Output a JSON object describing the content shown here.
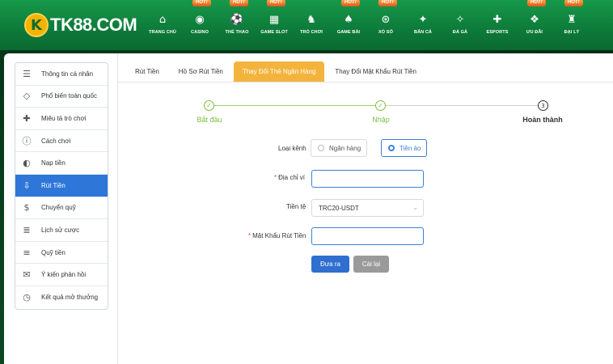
{
  "brand": {
    "logo_mark": "K",
    "logo_text": "TK88.COM",
    "accent": "#0d7a39",
    "gold": "#f5b301"
  },
  "nav": [
    {
      "label": "TRANG CHỦ",
      "icon": "home-icon",
      "glyph": "⌂",
      "hot": false
    },
    {
      "label": "CASINO",
      "icon": "casino-chip-icon",
      "glyph": "◉",
      "hot": true
    },
    {
      "label": "THỂ THAO",
      "icon": "soccer-ball-icon",
      "glyph": "⚽",
      "hot": true
    },
    {
      "label": "GAME SLOT",
      "icon": "slot-machine-icon",
      "glyph": "▦",
      "hot": true
    },
    {
      "label": "TRÒ CHƠI",
      "icon": "chess-knight-icon",
      "glyph": "♞",
      "hot": false
    },
    {
      "label": "GAME BÀI",
      "icon": "cards-icon",
      "glyph": "♠",
      "hot": true
    },
    {
      "label": "XỔ SỐ",
      "icon": "lottery-ball-icon",
      "glyph": "⊛",
      "hot": true
    },
    {
      "label": "BẮN CÁ",
      "icon": "fish-icon",
      "glyph": "✦",
      "hot": false
    },
    {
      "label": "ĐÁ GÀ",
      "icon": "rooster-icon",
      "glyph": "✧",
      "hot": false
    },
    {
      "label": "ESPORTS",
      "icon": "gamepad-icon",
      "glyph": "✚",
      "hot": false
    },
    {
      "label": "ƯU ĐÃI",
      "icon": "gift-icon",
      "glyph": "❖",
      "hot": true
    },
    {
      "label": "ĐẠI LÝ",
      "icon": "agent-icon",
      "glyph": "♜",
      "hot": true
    }
  ],
  "hot_label": "HOT!",
  "sidebar": {
    "items": [
      {
        "label": "Thông tin cá nhân",
        "icon": "profile-card-icon",
        "glyph": "☰",
        "active": false
      },
      {
        "label": "Phổ biến toàn quốc",
        "icon": "diamond-icon",
        "glyph": "◇",
        "active": false
      },
      {
        "label": "Miêu tả trò chơi",
        "icon": "gamepad-icon",
        "glyph": "✚",
        "active": false
      },
      {
        "label": "Cách chơi",
        "icon": "info-icon",
        "glyph": "ⓘ",
        "active": false
      },
      {
        "label": "Nạp tiền",
        "icon": "piggy-bank-icon",
        "glyph": "◐",
        "active": false
      },
      {
        "label": "Rút Tiền",
        "icon": "withdraw-icon",
        "glyph": "⇩",
        "active": true
      },
      {
        "label": "Chuyển quỹ",
        "icon": "transfer-coin-icon",
        "glyph": "$",
        "active": false
      },
      {
        "label": "Lịch sử cược",
        "icon": "history-list-icon",
        "glyph": "≣",
        "active": false
      },
      {
        "label": "Quỹ tiền",
        "icon": "funds-icon",
        "glyph": "≡",
        "active": false
      },
      {
        "label": "Ý kiến phản hồi",
        "icon": "chat-bubble-icon",
        "glyph": "✉",
        "active": false
      },
      {
        "label": "Kết quả mở thưởng",
        "icon": "clock-history-icon",
        "glyph": "◷",
        "active": false
      }
    ]
  },
  "tabs": [
    {
      "label": "Rút Tiền",
      "active": false
    },
    {
      "label": "Hồ Sơ Rút Tiền",
      "active": false
    },
    {
      "label": "Thay Đổi Thẻ Ngân Hàng",
      "active": true
    },
    {
      "label": "Thay Đổi Mật Khẩu Rút Tiền",
      "active": false
    }
  ],
  "steps": [
    {
      "label": "Bắt đầu",
      "marker": "✓",
      "state": "done"
    },
    {
      "label": "Nhập",
      "marker": "✓",
      "state": "done"
    },
    {
      "label": "Hoàn thành",
      "marker": "3",
      "state": "current"
    }
  ],
  "form": {
    "channel_label": "Loại kênh",
    "channel_options": [
      {
        "label": "Ngân hàng",
        "selected": false
      },
      {
        "label": "Tiền ảo",
        "selected": true
      }
    ],
    "wallet_label": "Địa chỉ ví",
    "wallet_value": "",
    "wallet_placeholder": "",
    "currency_label": "Tiền tệ",
    "currency_value": "TRC20-USDT",
    "password_label": "Mật Khẩu Rút Tiền",
    "password_value": "",
    "required_mark": "*",
    "submit_label": "Đưa ra",
    "reset_label": "Cài lại"
  }
}
